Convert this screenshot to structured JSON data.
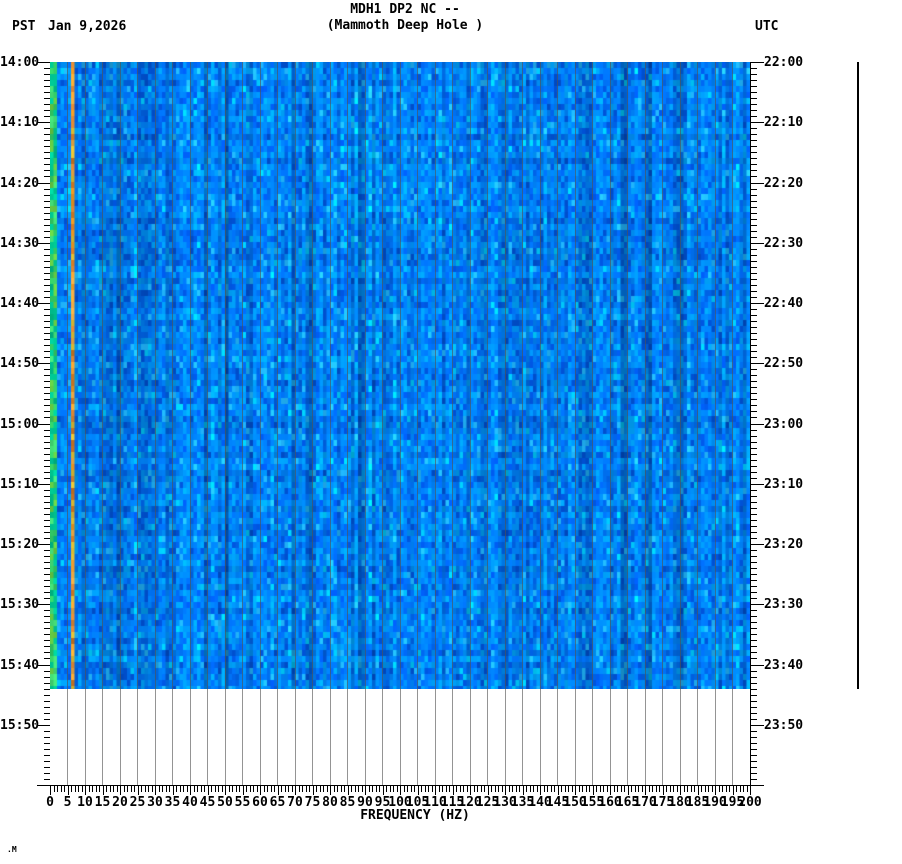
{
  "header": {
    "title_line1": "MDH1 DP2 NC --",
    "title_line2": "(Mammoth Deep Hole )",
    "left_timezone": "PST",
    "date": "Jan 9,2026",
    "right_timezone": "UTC"
  },
  "footer": {
    "mark": ".M"
  },
  "chart_data": {
    "type": "heatmap",
    "title": "MDH1 DP2 NC --",
    "subtitle": "(Mammoth Deep Hole )",
    "xlabel": "FREQUENCY (HZ)",
    "x_axis": {
      "min_hz": 0,
      "max_hz": 200,
      "label_step_hz": 5,
      "minor_tick_step_hz": 1,
      "tick_labels": [
        "0",
        "5",
        "10",
        "15",
        "20",
        "25",
        "30",
        "35",
        "40",
        "45",
        "50",
        "55",
        "60",
        "65",
        "70",
        "75",
        "80",
        "85",
        "90",
        "95",
        "100",
        "105",
        "110",
        "115",
        "120",
        "125",
        "130",
        "135",
        "140",
        "145",
        "150",
        "155",
        "160",
        "165",
        "170",
        "175",
        "180",
        "185",
        "190",
        "195",
        "200"
      ]
    },
    "y_axis_left": {
      "timezone": "PST",
      "date": "Jan 9,2026",
      "start": "14:00",
      "end": "16:00",
      "label_step_min": 10,
      "minor_tick_step_min": 1,
      "labels": [
        "14:00",
        "14:10",
        "14:20",
        "14:30",
        "14:40",
        "14:50",
        "15:00",
        "15:10",
        "15:20",
        "15:30",
        "15:40",
        "15:50"
      ]
    },
    "y_axis_right": {
      "timezone": "UTC",
      "start": "22:00",
      "end": "00:00",
      "label_step_min": 10,
      "minor_tick_step_min": 1,
      "labels": [
        "22:00",
        "22:10",
        "22:20",
        "22:30",
        "22:40",
        "22:50",
        "23:00",
        "23:10",
        "23:20",
        "23:30",
        "23:40",
        "23:50"
      ]
    },
    "data_coverage": {
      "start_pst": "14:00",
      "end_pst": "15:44",
      "note": "spectrogram fill ends at 15:44 PST; area below is blank white with gridlines and ticks only"
    },
    "grid": {
      "vertical_step_hz": 5,
      "horizontal": false,
      "color": "#808080"
    },
    "features": [
      {
        "name": "broadband-noise",
        "freq_hz": [
          0,
          200
        ],
        "description": "continuous mottled blue background noise, no transient events"
      },
      {
        "name": "low-frequency-band",
        "freq_hz": [
          0,
          1.2
        ],
        "description": "persistent green/teal column at left edge"
      },
      {
        "name": "tonal-line",
        "freq_hz": [
          6.0,
          6.8
        ],
        "description": "persistent narrow orange spectral line"
      }
    ],
    "colors": {
      "background": "#ffffff",
      "axis": "#000000",
      "noise_palette": [
        "#0055dd",
        "#0066ee",
        "#0077ff",
        "#0085ff",
        "#0095ff",
        "#00a5ff",
        "#22b7ff",
        "#00ccff"
      ],
      "noise_weights": [
        1.5,
        2.5,
        4,
        4,
        3,
        2,
        1,
        0.5
      ],
      "band_palette": [
        "#33cc66",
        "#00cc99",
        "#66cc44",
        "#00bb88",
        "#44dd77"
      ],
      "tonal_palette": [
        "#ee9922",
        "#dd8833",
        "#ffaa33",
        "#cc7722",
        "#eeaa44",
        "#ddbb33"
      ]
    },
    "amplitude_trace": {
      "present": true,
      "color": "#000000",
      "description": "flat vertical helicorder trace in right margin spanning the recorded interval"
    }
  }
}
